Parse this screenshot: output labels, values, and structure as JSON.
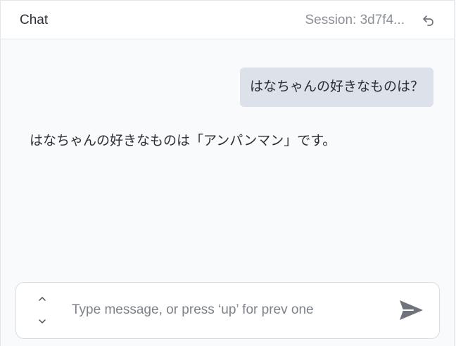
{
  "header": {
    "title": "Chat",
    "session_label": "Session: 3d7f4...",
    "undo_icon": "undo-icon"
  },
  "messages": [
    {
      "role": "user",
      "text": "はなちゃんの好きなものは？"
    },
    {
      "role": "assistant",
      "text": "はなちゃんの好きなものは「アンパンマン」です。"
    }
  ],
  "input": {
    "placeholder": "Type message, or press ‘up’ for prev one",
    "value": "",
    "history_up_icon": "chevron-up-icon",
    "history_down_icon": "chevron-down-icon",
    "send_icon": "send-icon"
  },
  "colors": {
    "background": "#f9fafc",
    "header_background": "#ffffff",
    "user_bubble": "#dde1ea",
    "muted_text": "#8c9099",
    "icon": "#6f737c"
  }
}
